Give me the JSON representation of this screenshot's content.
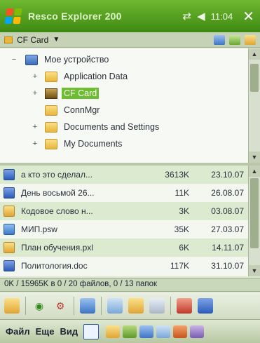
{
  "titlebar": {
    "app_title": "Resco Explorer 200",
    "clock": "11:04",
    "connectivity_icon": "connectivity-arrows-icon",
    "volume_icon": "speaker-icon",
    "close_glyph": "✕"
  },
  "location": {
    "label": "CF Card",
    "arrow": "▼"
  },
  "tree": {
    "items": [
      {
        "label": "Мое устройство",
        "expander": "−",
        "icon": "device-icon"
      },
      {
        "label": "Application Data",
        "expander": "+",
        "icon": "folder-icon"
      },
      {
        "label": "CF Card",
        "expander": "+",
        "icon": "storage-card-icon",
        "selected": true
      },
      {
        "label": "ConnMgr",
        "expander": "",
        "icon": "folder-icon"
      },
      {
        "label": "Documents and Settings",
        "expander": "+",
        "icon": "folder-icon"
      },
      {
        "label": "My Documents",
        "expander": "+",
        "icon": "folder-icon"
      }
    ]
  },
  "files": {
    "rows": [
      {
        "name": "а кто это сделал...",
        "size": "3613K",
        "date": "23.10.07",
        "icon": "doc-icon"
      },
      {
        "name": "День восьмой 26...",
        "size": "11K",
        "date": "26.08.07",
        "icon": "doc-icon"
      },
      {
        "name": "Кодовое слово н...",
        "size": "3K",
        "date": "03.08.07",
        "icon": "folder-icon"
      },
      {
        "name": "МИП.psw",
        "size": "35K",
        "date": "27.03.07",
        "icon": "image-icon"
      },
      {
        "name": "План обучения.pxl",
        "size": "6K",
        "date": "14.11.07",
        "icon": "folder-icon"
      },
      {
        "name": "Политология.doc",
        "size": "117K",
        "date": "31.10.07",
        "icon": "doc-icon"
      }
    ]
  },
  "status": {
    "text": "0K / 15965K в 0 / 20 файлов, 0 / 13 папок"
  },
  "toolbar": {
    "tools": [
      "new-folder-icon",
      "refresh-icon",
      "settings-icon",
      "copy-icon",
      "paste-icon",
      "move-icon",
      "rename-icon",
      "delete-icon",
      "properties-icon"
    ]
  },
  "menubar": {
    "file": "Файл",
    "more": "Еще",
    "view": "Вид",
    "icons": [
      "keyboard-icon",
      "folder-up-icon",
      "cut-icon",
      "copy-icon",
      "paste-icon",
      "send-icon",
      "more-icon"
    ]
  },
  "colors": {
    "accent": "#4f9a1f",
    "selection": "#6cbd2f",
    "row_alt": "#dcebd0"
  }
}
